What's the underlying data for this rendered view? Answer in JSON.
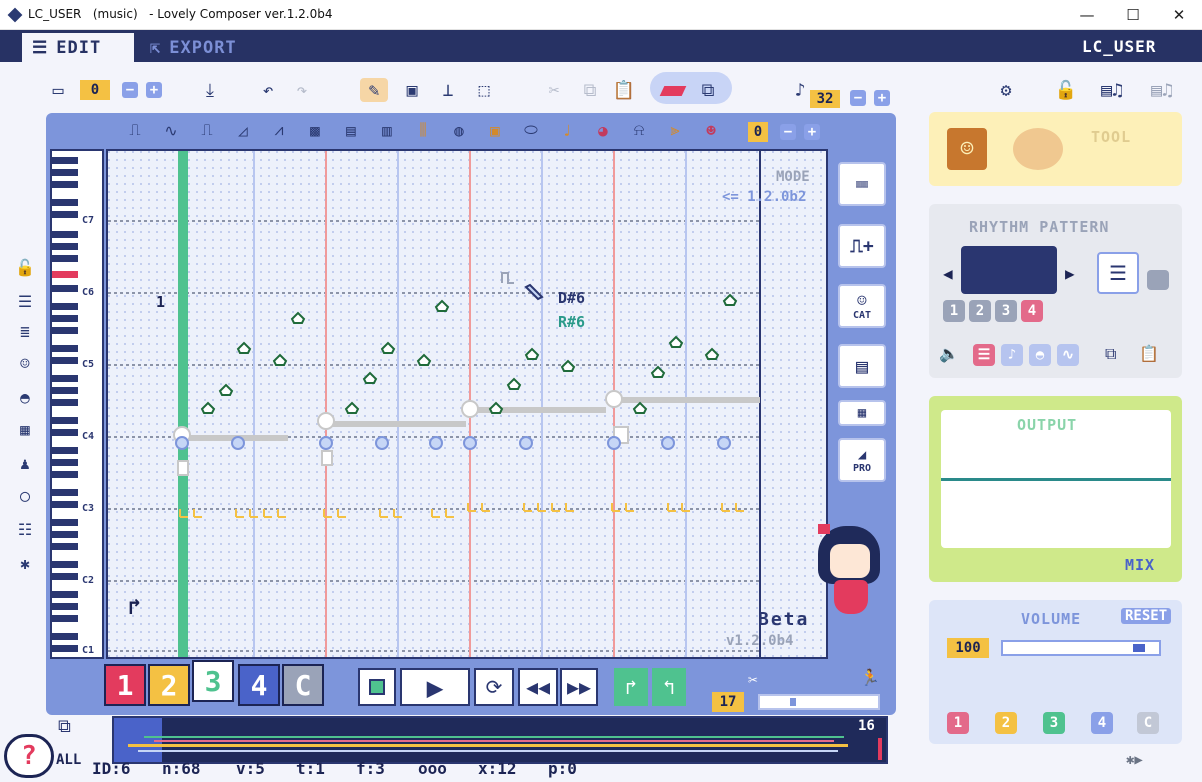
{
  "window": {
    "title": "LC_USER   (music)   - Lovely Composer ver.1.2.0b4",
    "minimize": "—",
    "maximize": "☐",
    "close": "✕"
  },
  "tabs": {
    "edit": "EDIT",
    "export": "EXPORT",
    "username": "LC_USER"
  },
  "toolbar": {
    "slot_value": "0",
    "note_length": "32"
  },
  "instrument_bar": {
    "value": "0"
  },
  "piano": {
    "labels": [
      "C7",
      "C6",
      "C5",
      "C4",
      "C3",
      "C2",
      "C1"
    ]
  },
  "roll": {
    "mode_label": "MODE",
    "mode_value": "<= 1.2.0b2",
    "beat_marker": "1",
    "note_line1": "D#6",
    "note_line2": "R#6",
    "beta_label": "Beta",
    "version_label": "v1.2.0b4"
  },
  "right_tools": {
    "pro_label": "PRO",
    "cat_label": "CAT"
  },
  "channels": [
    "1",
    "2",
    "3",
    "4",
    "C"
  ],
  "transport": {
    "position": "17"
  },
  "sequence": {
    "page_count": "16"
  },
  "status": {
    "all": "ALL",
    "id": "ID:6",
    "n": "n:68",
    "v": "v:5",
    "t": "t:1",
    "f": "f:3",
    "dots": "ooo",
    "x": "x:12",
    "p": "p:0"
  },
  "side": {
    "tool_label": "TOOL",
    "rhythm_title": "RHYTHM PATTERN",
    "rhythm_nums": [
      "1",
      "2",
      "3",
      "4"
    ],
    "output_title": "OUTPUT",
    "mix_label": "MIX",
    "volume_title": "VOLUME",
    "reset_label": "RESET",
    "volume_value": "100",
    "channel_nums": [
      "1",
      "2",
      "3",
      "4",
      "C"
    ]
  },
  "colors": {
    "navy": "#273264",
    "accent_red": "#e33b5e",
    "accent_yellow": "#f4c143",
    "accent_green": "#4fc28f",
    "accent_blue": "#4a63c9",
    "grey": "#9aa3b8"
  }
}
